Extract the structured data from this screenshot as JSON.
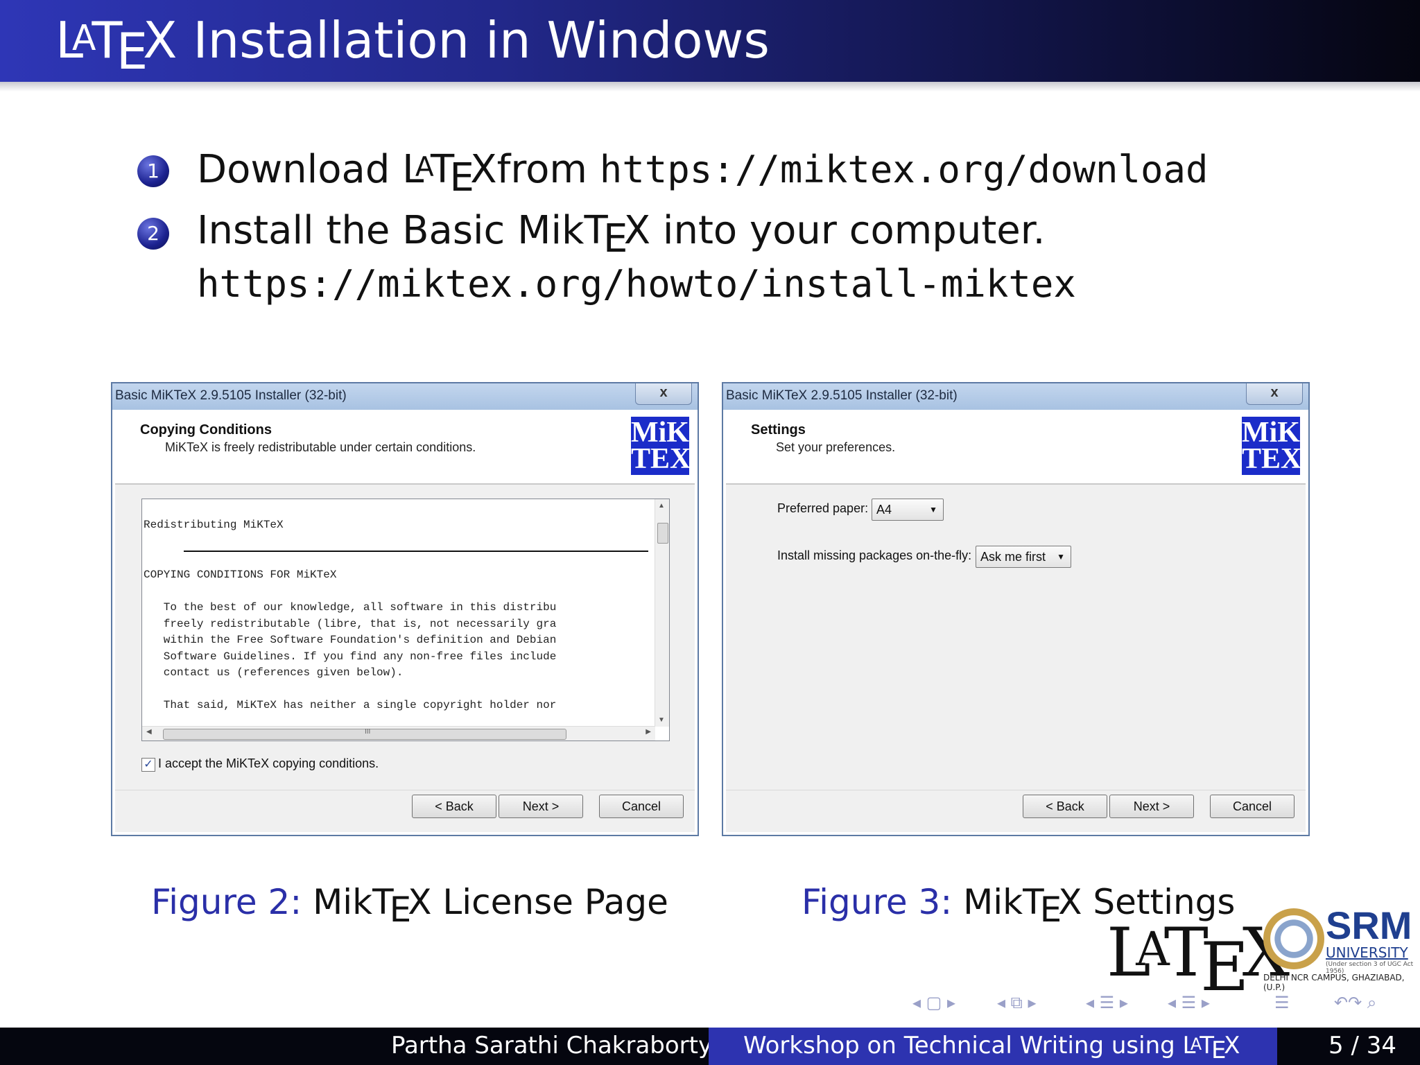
{
  "slide": {
    "title": "Installation in Windows",
    "latex_word": {
      "L": "L",
      "A": "A",
      "T": "T",
      "E": "E",
      "X": "X"
    }
  },
  "steps": [
    {
      "number": "1",
      "prefix": "Download ",
      "suffix": "from ",
      "url": "https://miktex.org/download"
    },
    {
      "number": "2",
      "prefix": "Install the Basic MikT",
      "suffix": "X into your computer.",
      "url": "https://miktex.org/howto/install-miktex"
    }
  ],
  "windows": [
    {
      "title": "Basic MiKTeX 2.9.5105 Installer (32-bit)",
      "close": "x",
      "header_title": "Copying Conditions",
      "header_sub": "MiKTeX is freely redistributable under certain conditions.",
      "logo": "MiK\nTEX",
      "license_heading": "Redistributing MiKTeX",
      "license_lines": [
        "COPYING CONDITIONS FOR MiKTeX",
        "",
        "   To the best of our knowledge, all software in this distribu",
        "   freely redistributable (libre, that is, not necessarily gra",
        "   within the Free Software Foundation's definition and Debian",
        "   Software Guidelines. If you find any non-free files include",
        "   contact us (references given below).",
        "",
        "   That said, MiKTeX has neither a single copyright holder nor"
      ],
      "scroll_mark": "III",
      "accept_label": "I accept the MiKTeX copying conditions.",
      "accept_checked": "✓",
      "buttons": {
        "back": "< Back",
        "next": "Next >",
        "cancel": "Cancel"
      }
    },
    {
      "title": "Basic MiKTeX 2.9.5105 Installer (32-bit)",
      "close": "x",
      "header_title": "Settings",
      "header_sub": "Set your preferences.",
      "logo": "MiK\nTEX",
      "paper_label": "Preferred paper:",
      "paper_value": "A4",
      "install_label": "Install missing packages on-the-fly:",
      "install_value": "Ask me first",
      "buttons": {
        "back": "< Back",
        "next": "Next >",
        "cancel": "Cancel"
      }
    }
  ],
  "captions": [
    {
      "fig": "Figure 2:",
      "text_a": "MikT",
      "text_b": "X License Page"
    },
    {
      "fig": "Figure 3:",
      "text_a": "MikT",
      "text_b": "X Settings"
    }
  ],
  "branding": {
    "srm": "SRM",
    "university": "UNIVERSITY",
    "under": "(Under section 3 of UGC Act 1956)",
    "campus": "DELHI NCR CAMPUS, GHAZIABAD, (U.P.)"
  },
  "footer": {
    "author": "Partha Sarathi Chakraborty",
    "workshop": "Workshop on Technical Writing using L",
    "page": "5 / 34"
  },
  "nav_icons": [
    "nav-frame-icon",
    "nav-subsection-icon",
    "nav-section-icon",
    "nav-outline-icon",
    "nav-search-icon"
  ]
}
